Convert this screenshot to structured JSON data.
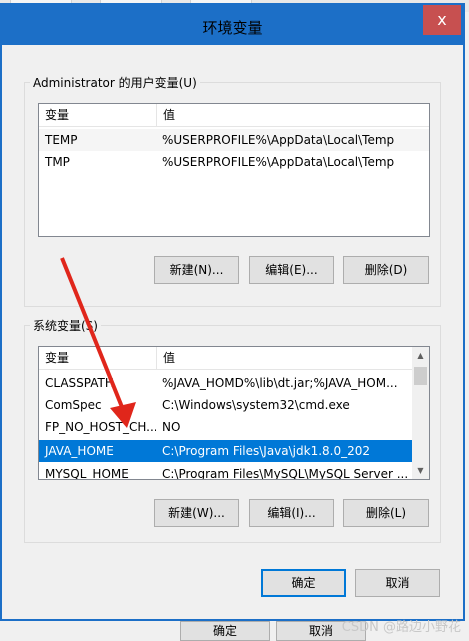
{
  "dialog": {
    "title": "环境变量",
    "close_label": "x"
  },
  "user_vars": {
    "group_label": "Administrator 的用户变量(U)",
    "col_variable": "变量",
    "col_value": "值",
    "rows": [
      {
        "name": "TEMP",
        "value": "%USERPROFILE%\\AppData\\Local\\Temp"
      },
      {
        "name": "TMP",
        "value": "%USERPROFILE%\\AppData\\Local\\Temp"
      }
    ],
    "new_label": "新建(N)...",
    "edit_label": "编辑(E)...",
    "delete_label": "删除(D)"
  },
  "system_vars": {
    "group_label": "系统变量(S)",
    "col_variable": "变量",
    "col_value": "值",
    "rows": [
      {
        "name": "CLASSPATH",
        "value": "%JAVA_HOMD%\\lib\\dt.jar;%JAVA_HOM..."
      },
      {
        "name": "ComSpec",
        "value": "C:\\Windows\\system32\\cmd.exe"
      },
      {
        "name": "FP_NO_HOST_CH...",
        "value": "NO"
      },
      {
        "name": "JAVA_HOME",
        "value": "C:\\Program Files\\Java\\jdk1.8.0_202"
      },
      {
        "name": "MYSQL_HOME",
        "value": "C:\\Program Files\\MySQL\\MySQL Server ..."
      }
    ],
    "new_label": "新建(W)...",
    "edit_label": "编辑(I)...",
    "delete_label": "删除(L)"
  },
  "footer": {
    "ok_label": "确定",
    "cancel_label": "取消"
  },
  "background_dialog": {
    "ok_label": "确定",
    "cancel_label": "取消"
  },
  "watermark": "CSDN @路边小野花",
  "colors": {
    "title_bar": "#1c6fc7",
    "close_button": "#c75050",
    "selection": "#0078d7",
    "annotation_arrow": "#e0261b"
  }
}
